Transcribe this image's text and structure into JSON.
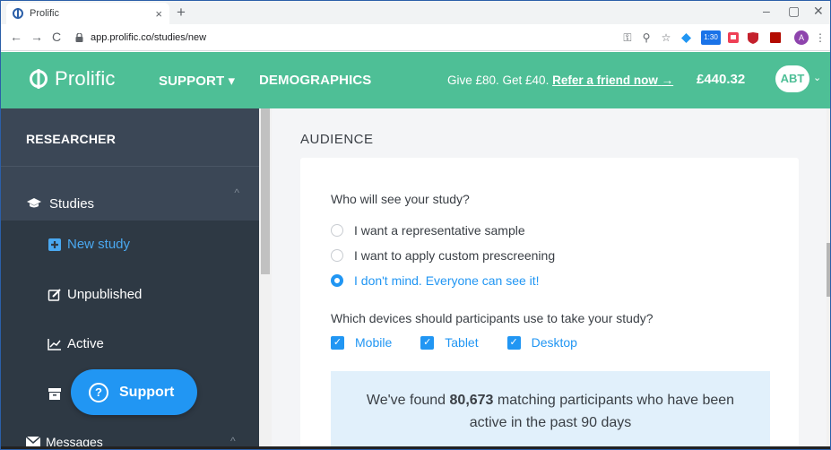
{
  "browser": {
    "tab_title": "Prolific",
    "tab_close": "×",
    "new_tab": "+",
    "url": "app.prolific.co/studies/new",
    "controls": {
      "minimize": "–",
      "maximize": "▢",
      "close": "✕"
    },
    "nav": {
      "back": "←",
      "forward": "→",
      "reload": "C"
    },
    "toolbar_icons": {
      "key": "⚿",
      "zoom": "⚲",
      "star": "☆",
      "badge": "1:30",
      "profile": "A",
      "menu": "⋮"
    }
  },
  "topnav": {
    "brand": "Prolific",
    "support": "SUPPORT",
    "support_caret": "▾",
    "demographics": "DEMOGRAPHICS",
    "promo_text": "Give £80. Get £40.",
    "promo_link": "Refer a friend now",
    "promo_arrow": "→",
    "balance": "£440.32",
    "avatar": "ABT",
    "avatar_caret": "⌄",
    "brand_color": "#4ebf96"
  },
  "sidebar": {
    "section": "RESEARCHER",
    "studies": "Studies",
    "studies_chevron": "^",
    "items": [
      {
        "label": "New study",
        "icon": "plus-square-icon"
      },
      {
        "label": "Unpublished",
        "icon": "edit-icon"
      },
      {
        "label": "Active",
        "icon": "line-chart-icon"
      }
    ],
    "messages": "Messages",
    "support_button": "Support",
    "support_icon": "?"
  },
  "main": {
    "section_title": "AUDIENCE",
    "question": "Who will see your study?",
    "options": [
      {
        "label": "I want a representative sample",
        "selected": false
      },
      {
        "label": "I want to apply custom prescreening",
        "selected": false
      },
      {
        "label": "I don't mind. Everyone can see it!",
        "selected": true
      }
    ],
    "devices_question": "Which devices should participants use to take your study?",
    "devices": [
      {
        "label": "Mobile",
        "checked": true
      },
      {
        "label": "Tablet",
        "checked": true
      },
      {
        "label": "Desktop",
        "checked": true
      }
    ],
    "check_mark": "✓",
    "result_prefix": "We've found",
    "result_count": "80,673",
    "result_suffix": "matching participants who have been",
    "result_line2": "active in the past 90 days",
    "accent_color": "#2196f3"
  }
}
